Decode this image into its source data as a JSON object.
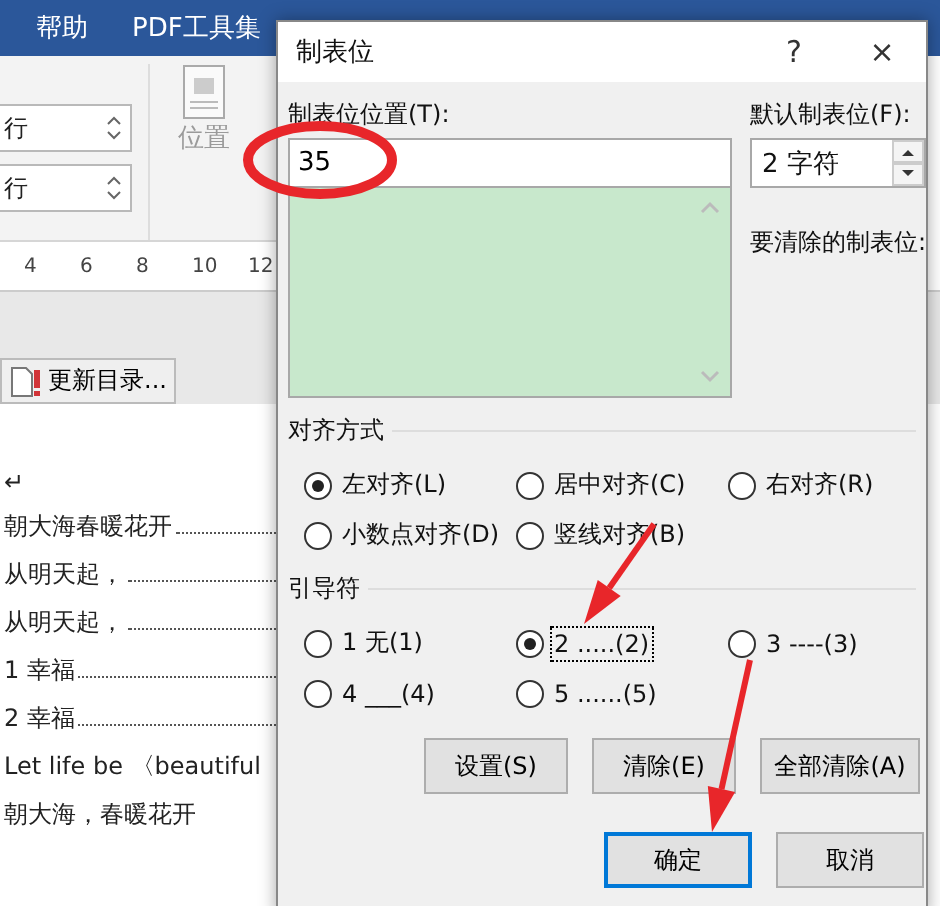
{
  "ribbon": {
    "tabs": [
      "帮助",
      "PDF工具集"
    ],
    "spinners": [
      "行",
      "行"
    ],
    "position_button": "位置"
  },
  "ruler": {
    "ticks": [
      "4",
      "6",
      "8",
      "10",
      "12"
    ]
  },
  "update_toc_button": "更新目录...",
  "document": {
    "lines": [
      {
        "text": "↵",
        "leader": false
      },
      {
        "text": "朝大海春暖花开",
        "leader": true
      },
      {
        "text": "从明天起，",
        "leader": true
      },
      {
        "text": "从明天起，",
        "leader": true
      },
      {
        "text": "1  幸福",
        "leader": true
      },
      {
        "text": "2  幸福",
        "leader": true
      },
      {
        "text": "Let life be 〈beautiful",
        "leader": false
      },
      {
        "text": "朝大海，春暖花开",
        "leader": false
      }
    ]
  },
  "dialog": {
    "title": "制表位",
    "help": "?",
    "close": "×",
    "tab_position": {
      "label": "制表位位置(T):",
      "value": "35"
    },
    "default_tab": {
      "label": "默认制表位(F):",
      "value": "2 字符"
    },
    "clear_label": "要清除的制表位:",
    "alignment": {
      "title": "对齐方式",
      "options": [
        {
          "label": "左对齐(L)",
          "selected": true
        },
        {
          "label": "居中对齐(C)",
          "selected": false
        },
        {
          "label": "右对齐(R)",
          "selected": false
        },
        {
          "label": "小数点对齐(D)",
          "selected": false
        },
        {
          "label": "竖线对齐(B)",
          "selected": false
        }
      ]
    },
    "leader": {
      "title": "引导符",
      "options": [
        {
          "label": "1 无(1)",
          "selected": false,
          "focused": false
        },
        {
          "label": "2 .....(2)",
          "selected": true,
          "focused": true
        },
        {
          "label": "3 ----(3)",
          "selected": false,
          "focused": false
        },
        {
          "label": "4 ___(4)",
          "selected": false,
          "focused": false
        },
        {
          "label": "5 ......(5)",
          "selected": false,
          "focused": false
        }
      ]
    },
    "buttons": [
      "设置(S)",
      "清除(E)",
      "全部清除(A)"
    ],
    "footer_buttons": [
      {
        "label": "确定",
        "default": true
      },
      {
        "label": "取消",
        "default": false
      }
    ]
  }
}
